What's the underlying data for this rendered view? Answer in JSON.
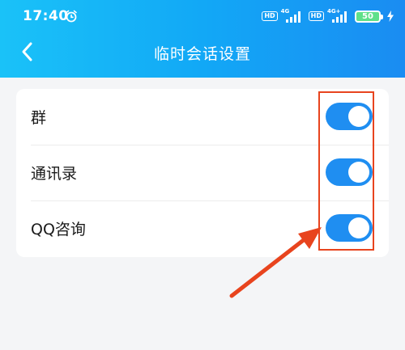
{
  "status_bar": {
    "time": "17:40",
    "hd_label": "HD",
    "network_1": "4G",
    "network_2": "4G+",
    "battery": "50",
    "icons": [
      "alarm-icon",
      "signal-icon",
      "battery-icon",
      "charging-icon"
    ]
  },
  "header": {
    "title": "临时会话设置",
    "back_icon": "chevron-left-icon"
  },
  "settings": {
    "items": [
      {
        "label": "群",
        "enabled": true
      },
      {
        "label": "通讯录",
        "enabled": true
      },
      {
        "label": "QQ咨询",
        "enabled": true
      }
    ]
  },
  "colors": {
    "header_start": "#1ac2f8",
    "header_end": "#1a8cf2",
    "toggle_on": "#1f8ef1",
    "page_background": "#f4f5f7",
    "annotation": "#e8441e"
  }
}
